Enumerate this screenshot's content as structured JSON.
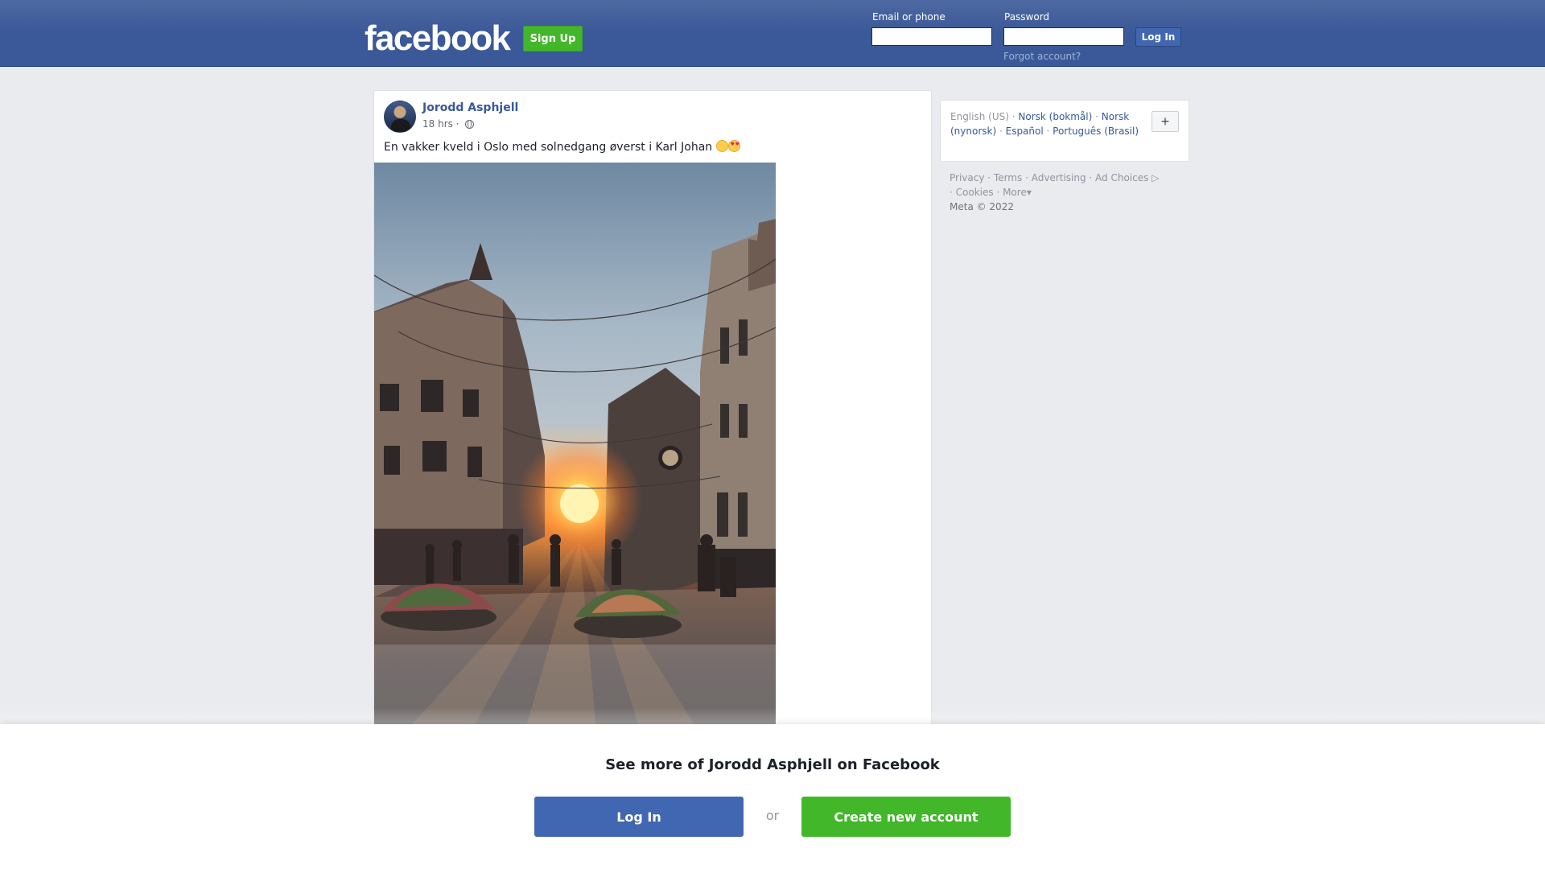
{
  "header": {
    "logo": "facebook",
    "signup_label": "Sign Up",
    "email_label": "Email or phone",
    "password_label": "Password",
    "login_label": "Log In",
    "forgot_label": "Forgot account?"
  },
  "post": {
    "author": "Jorodd Asphjell",
    "time": "18 hrs ·",
    "text": "En vakker kveld i Oslo med solnedgang øverst i Karl Johan",
    "privacy_icon": "globe-icon",
    "emoji": [
      "smiling-face-icon",
      "heart-eyes-icon"
    ]
  },
  "sidebar": {
    "languages": [
      {
        "label": "English (US)",
        "current": true
      },
      {
        "label": "Norsk (bokmål)",
        "current": false
      },
      {
        "label": "Norsk (nynorsk)",
        "current": false
      },
      {
        "label": "Español",
        "current": false
      },
      {
        "label": "Português (Brasil)",
        "current": false
      }
    ],
    "add_language_label": "+",
    "footer_links": [
      "Privacy",
      "Terms",
      "Advertising",
      "Ad Choices",
      "Cookies",
      "More"
    ],
    "copyright": "Meta © 2022"
  },
  "overlay": {
    "title": "See more of Jorodd Asphjell on Facebook",
    "login_label": "Log In",
    "or_label": "or",
    "create_label": "Create new account"
  },
  "colors": {
    "brand_blue": "#3b5998",
    "button_blue": "#4267b2",
    "signup_green": "#42b72a",
    "link_blue": "#385898",
    "page_background": "#e9ebee"
  }
}
